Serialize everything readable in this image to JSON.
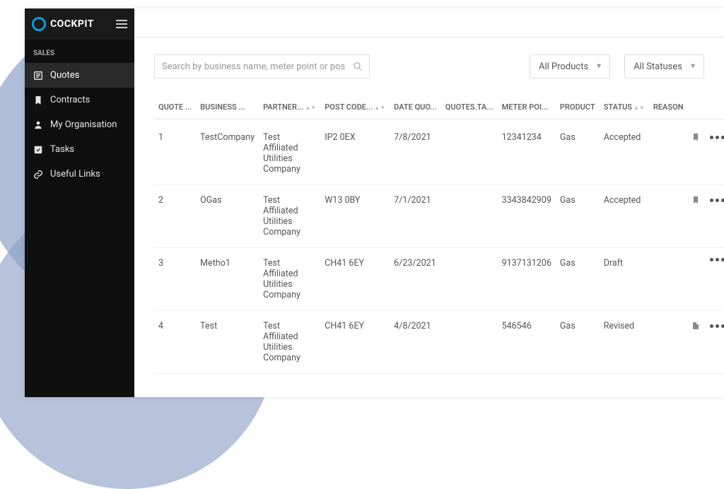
{
  "brand": "COCKPIT",
  "sidebar": {
    "section": "SALES",
    "items": [
      {
        "label": "Quotes",
        "active": true,
        "icon": "quotes"
      },
      {
        "label": "Contracts",
        "active": false,
        "icon": "contracts"
      },
      {
        "label": "My Organisation",
        "active": false,
        "icon": "org"
      },
      {
        "label": "Tasks",
        "active": false,
        "icon": "tasks"
      },
      {
        "label": "Useful Links",
        "active": false,
        "icon": "links"
      }
    ]
  },
  "filters": {
    "search_placeholder": "Search by business name, meter point or post code",
    "product_dropdown": "All Products",
    "status_dropdown": "All Statuses"
  },
  "table": {
    "headers": [
      "QUOTE ...",
      "BUSINESS ...",
      "PARTNER...",
      "POST CODE...",
      "DATE QUO...",
      "QUOTES.TA...",
      "METER POI...",
      "PRODUCT",
      "STATUS",
      "REASON"
    ],
    "rows": [
      {
        "quote": "1",
        "business": "TestCompany",
        "partner": "Test Affiliated Utilities Company",
        "postcode": "IP2 0EX",
        "date": "7/8/2021",
        "tag": "",
        "meter": "12341234",
        "product": "Gas",
        "status": "Accepted",
        "reason": "",
        "bookmark": true
      },
      {
        "quote": "2",
        "business": "OGas",
        "partner": "Test Affiliated Utilities Company",
        "postcode": "W13 0BY",
        "date": "7/1/2021",
        "tag": "",
        "meter": "3343842909",
        "product": "Gas",
        "status": "Accepted",
        "reason": "",
        "bookmark": true
      },
      {
        "quote": "3",
        "business": "Metho1",
        "partner": "Test Affiliated Utilities Company",
        "postcode": "CH41 6EY",
        "date": "6/23/2021",
        "tag": "",
        "meter": "9137131206",
        "product": "Gas",
        "status": "Draft",
        "reason": "",
        "bookmark": false
      },
      {
        "quote": "4",
        "business": "Test",
        "partner": "Test Affiliated Utilities Company",
        "postcode": "CH41 6EY",
        "date": "4/8/2021",
        "tag": "",
        "meter": "546546",
        "product": "Gas",
        "status": "Revised",
        "reason": "",
        "bookmark": true,
        "bookmark_alt": true
      }
    ]
  }
}
